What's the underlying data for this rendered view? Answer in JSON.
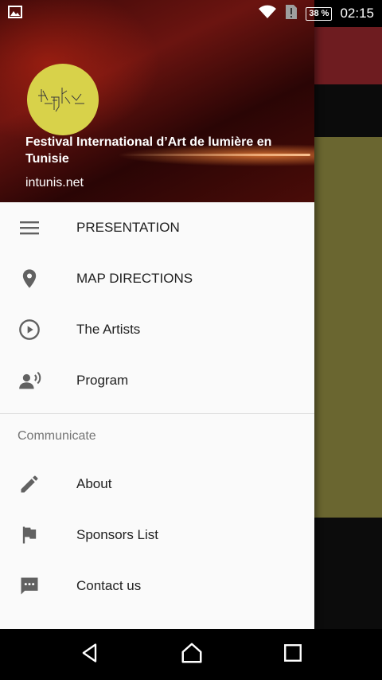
{
  "status_bar": {
    "battery": "38 %",
    "time": "02:15"
  },
  "header": {
    "title": "Festival International d’Art de lumière en Tunisie",
    "subtitle": "intunis.net"
  },
  "menu": {
    "primary": [
      {
        "label": "PRESENTATION",
        "icon": "menu-lines-icon"
      },
      {
        "label": "MAP DIRECTIONS",
        "icon": "location-pin-icon"
      },
      {
        "label": "The Artists",
        "icon": "play-circle-icon"
      },
      {
        "label": "Program",
        "icon": "record-voice-icon"
      }
    ],
    "section_title": "Communicate",
    "secondary": [
      {
        "label": "About",
        "icon": "pencil-icon"
      },
      {
        "label": "Sponsors List",
        "icon": "flag-icon"
      },
      {
        "label": "Contact us",
        "icon": "message-icon"
      }
    ]
  },
  "colors": {
    "drawer_bg": "#fafafa",
    "icon": "#616161",
    "avatar": "#d8d24a",
    "background_olive": "#6a6630",
    "background_toolbar": "#6e1c20"
  }
}
